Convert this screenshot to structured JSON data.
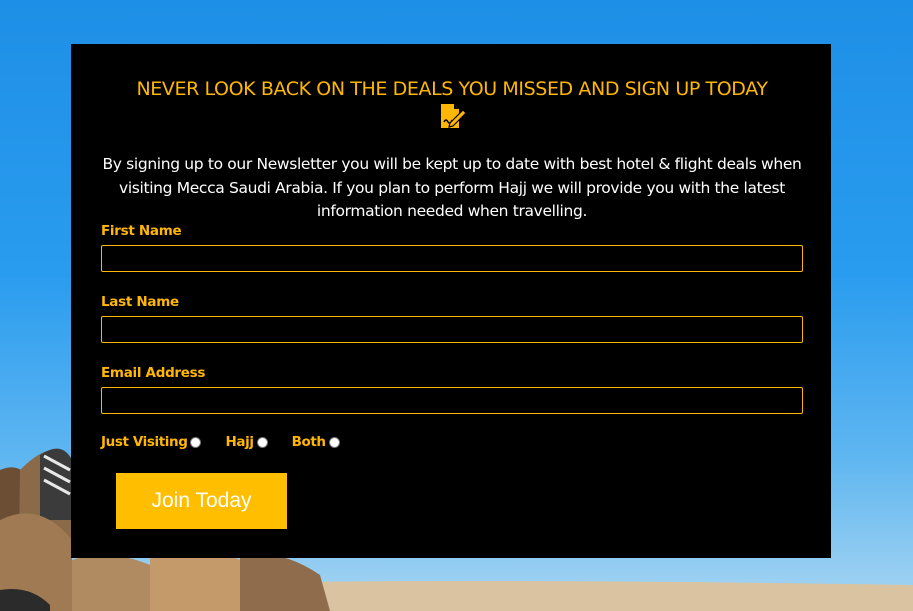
{
  "newsletter": {
    "headline": "NEVER LOOK BACK ON THE DEALS YOU MISSED AND SIGN UP TODAY",
    "headline_icon": "signature-document-icon",
    "intro": "By signing up to our Newsletter you will be kept up to date with best hotel & flight deals when visiting Mecca Saudi Arabia. If you plan to perform Hajj we will provide you with the latest information needed when travelling."
  },
  "form": {
    "first_name": {
      "label": "First Name",
      "value": "",
      "placeholder": ""
    },
    "last_name": {
      "label": "Last Name",
      "value": "",
      "placeholder": ""
    },
    "email": {
      "label": "Email Address",
      "value": "",
      "placeholder": ""
    },
    "visit_type": {
      "options": [
        {
          "label": "Just Visiting",
          "checked": false
        },
        {
          "label": "Hajj",
          "checked": false
        },
        {
          "label": "Both",
          "checked": false
        }
      ]
    },
    "submit_label": "Join Today"
  },
  "colors": {
    "accent": "#ffb703",
    "button": "#ffbf00",
    "panel": "#000000",
    "sky": "#2196f3"
  }
}
